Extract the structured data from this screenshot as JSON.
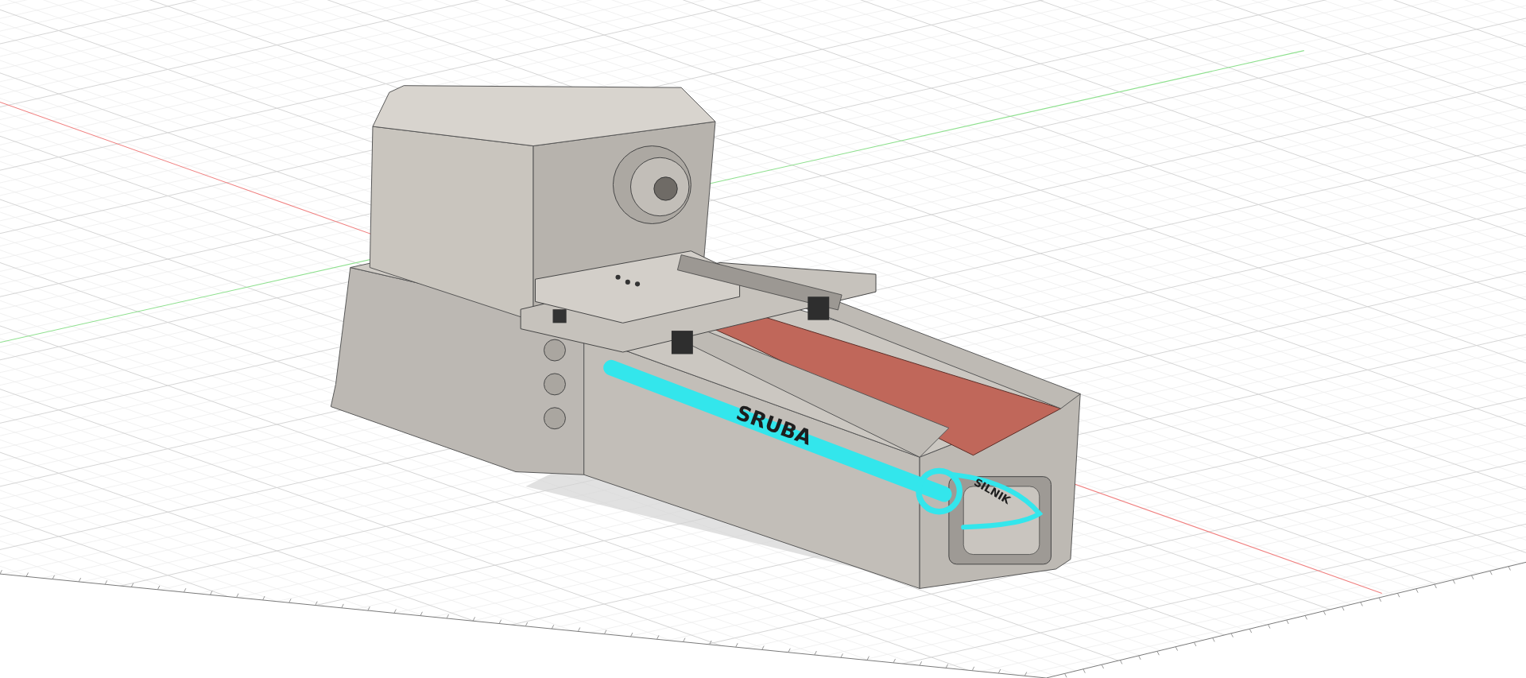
{
  "viewport": {
    "annotations": [
      {
        "kind": "line-label",
        "text": "SRUBA"
      },
      {
        "kind": "loop-label",
        "text": "SILNIK"
      }
    ]
  }
}
